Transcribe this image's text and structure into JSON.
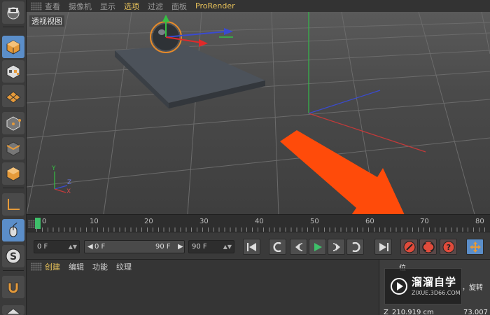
{
  "menu": {
    "items": [
      "查看",
      "摄像机",
      "显示",
      "选项",
      "过滤",
      "面板",
      "ProRender"
    ],
    "active_index": 3
  },
  "viewport": {
    "label": "透视视图",
    "axis_labels": {
      "y": "Y",
      "z": "Z",
      "x": "X"
    }
  },
  "timeline": {
    "ticks": [
      "0",
      "10",
      "20",
      "30",
      "40",
      "50",
      "60",
      "70",
      "80"
    ],
    "current_frame": "0"
  },
  "transport": {
    "start_field": "0 F",
    "range_start": "0 F",
    "range_end": "90 F",
    "end_field": "90 F"
  },
  "bottom_menu": {
    "items": [
      "创建",
      "编辑",
      "功能",
      "纹理"
    ]
  },
  "right_panel": {
    "text1": "位",
    "text2": "，旋转",
    "text3": "210.919 cm",
    "text4": "Z",
    "text5": "73.007"
  },
  "watermark": {
    "title": "溜溜自学",
    "subtitle": "ZIXUE.3D66.COM"
  },
  "colors": {
    "accent": "#e8c25a",
    "play_green": "#3ec06a",
    "record_red": "#e14b3b",
    "arrow_orange": "#ff4b0a",
    "active_blue": "#5b8ec9"
  }
}
